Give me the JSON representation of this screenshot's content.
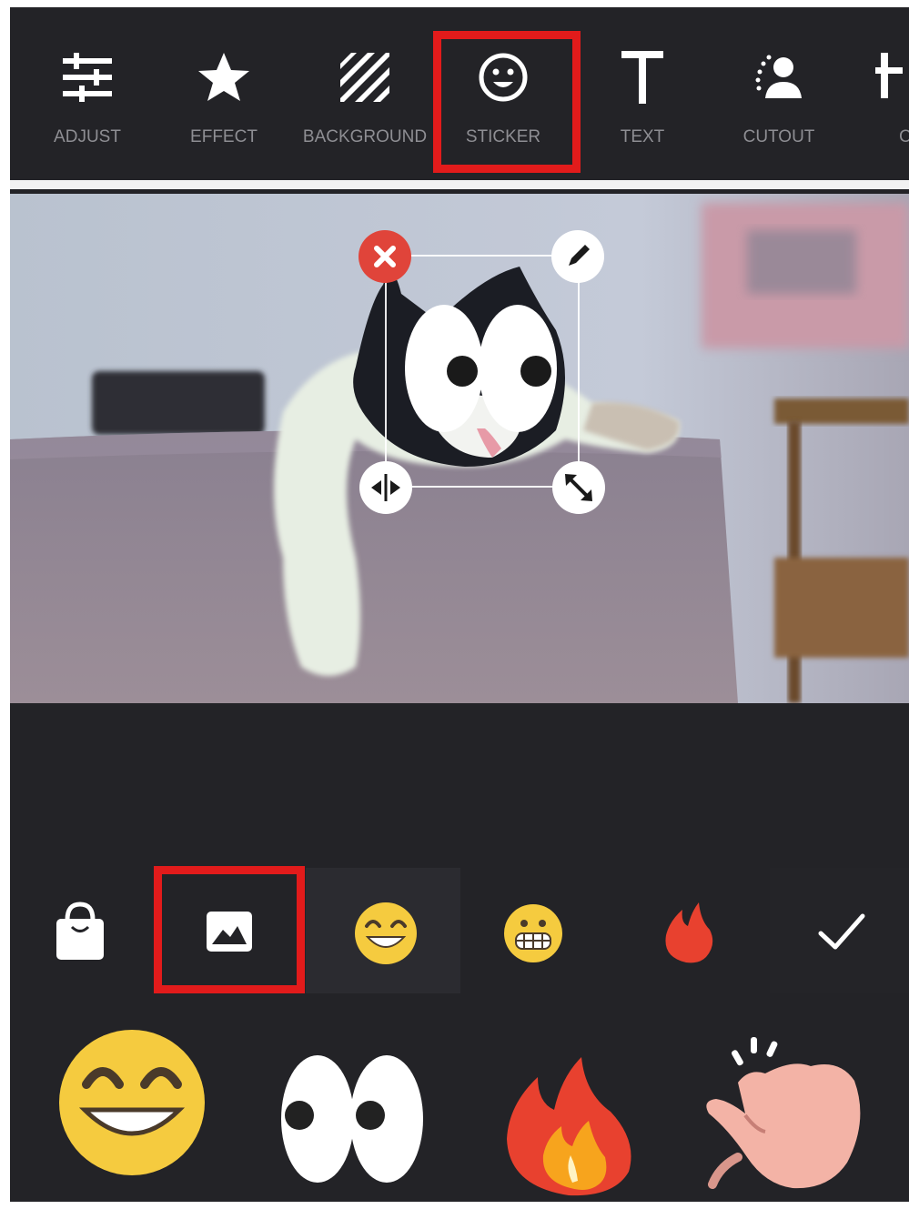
{
  "toolbar": {
    "tools": [
      {
        "label": "ADJUST",
        "icon": "sliders-icon"
      },
      {
        "label": "EFFECT",
        "icon": "star-icon"
      },
      {
        "label": "BACKGROUND",
        "icon": "stripes-icon"
      },
      {
        "label": "STICKER",
        "icon": "smiley-icon",
        "selected": true
      },
      {
        "label": "TEXT",
        "icon": "text-t-icon"
      },
      {
        "label": "CUTOUT",
        "icon": "person-cutout-icon"
      },
      {
        "label": "C",
        "icon": "crop-icon"
      }
    ]
  },
  "sticker_controls": [
    "delete-icon",
    "edit-pencil-icon",
    "flip-icon",
    "resize-icon"
  ],
  "category_tabs": [
    {
      "icon": "shopping-bag-icon"
    },
    {
      "icon": "image-icon",
      "selected": true
    },
    {
      "icon": "grin-emoji-icon"
    },
    {
      "icon": "grimace-emoji-icon"
    },
    {
      "icon": "fire-icon"
    }
  ],
  "confirm_icon": "checkmark-icon",
  "stickers": [
    "grinning-face-sticker",
    "googly-eyes-sticker",
    "fire-sticker",
    "clapping-hand-sticker"
  ],
  "colors": {
    "background": "#232327",
    "highlight": "#e21b1b",
    "delete": "#e0443a"
  }
}
